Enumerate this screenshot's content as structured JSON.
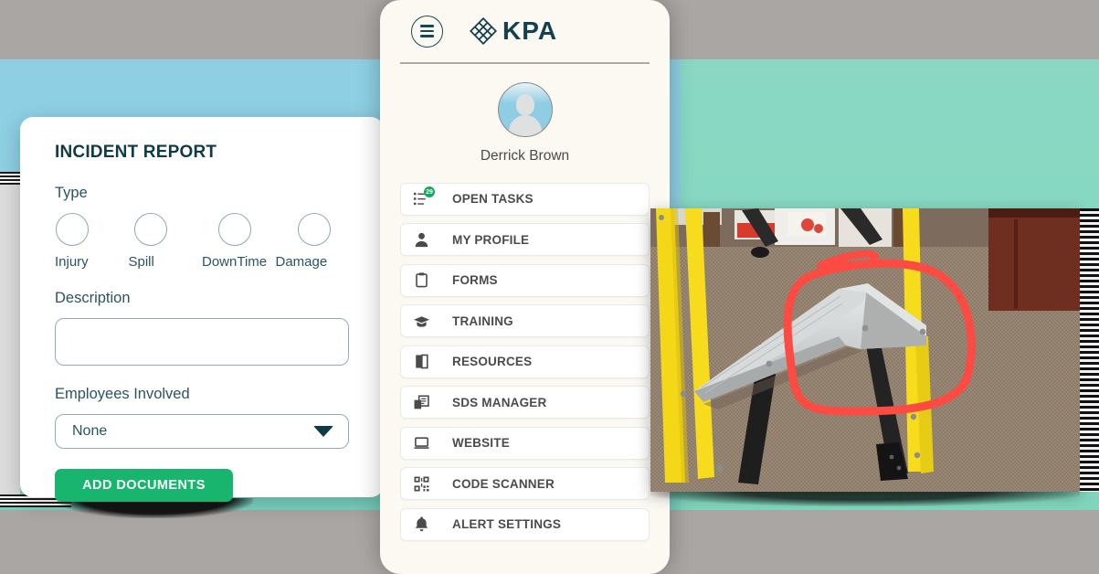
{
  "background": {
    "top_band_color": "#a9a6a4",
    "blue_band_color": "#8ecfe4",
    "teal_band_color": "#84d7c0",
    "bottom_band_color": "#a9a6a4"
  },
  "incident_card": {
    "title": "INCIDENT REPORT",
    "type_label": "Type",
    "type_options": [
      {
        "name": "Injury",
        "selected": false
      },
      {
        "name": "Spill",
        "selected": false
      },
      {
        "name": "DownTime",
        "selected": false
      },
      {
        "name": "Damage",
        "selected": false
      }
    ],
    "description_label": "Description",
    "description_value": "",
    "description_placeholder": "",
    "employees_label": "Employees Involved",
    "employees_value": "None",
    "employees_options": [
      "None"
    ],
    "add_documents_label": "ADD DOCUMENTS",
    "add_documents_color": "#17b56d"
  },
  "phone": {
    "menu_icon": "hamburger-menu-icon",
    "brand": "KPA",
    "brand_color": "#14414e",
    "logo_icon": "kpa-diamond-lattice-logo",
    "user": {
      "name": "Derrick Brown",
      "avatar_icon": "user-avatar-placeholder"
    },
    "menu_items": [
      {
        "label": "OPEN TASKS",
        "icon": "task-list-icon",
        "badge": "29"
      },
      {
        "label": "MY PROFILE",
        "icon": "person-icon",
        "badge": ""
      },
      {
        "label": "FORMS",
        "icon": "clipboard-icon",
        "badge": ""
      },
      {
        "label": "TRAINING",
        "icon": "graduation-cap-icon",
        "badge": ""
      },
      {
        "label": "RESOURCES",
        "icon": "book-icon",
        "badge": ""
      },
      {
        "label": "SDS MANAGER",
        "icon": "documents-icon",
        "badge": ""
      },
      {
        "label": "WEBSITE",
        "icon": "monitor-icon",
        "badge": ""
      },
      {
        "label": "CODE SCANNER",
        "icon": "qr-code-icon",
        "badge": ""
      },
      {
        "label": "ALERT SETTINGS",
        "icon": "bell-icon",
        "badge": ""
      }
    ]
  },
  "photo": {
    "description": "Yellow fiberglass step ladder on brown carpet with damaged bent aluminum step, annotated with a hand-drawn red circle",
    "annotation_color": "#f9423a",
    "ladder_color": "#f5d916",
    "carpet_color": "#9a8573"
  }
}
